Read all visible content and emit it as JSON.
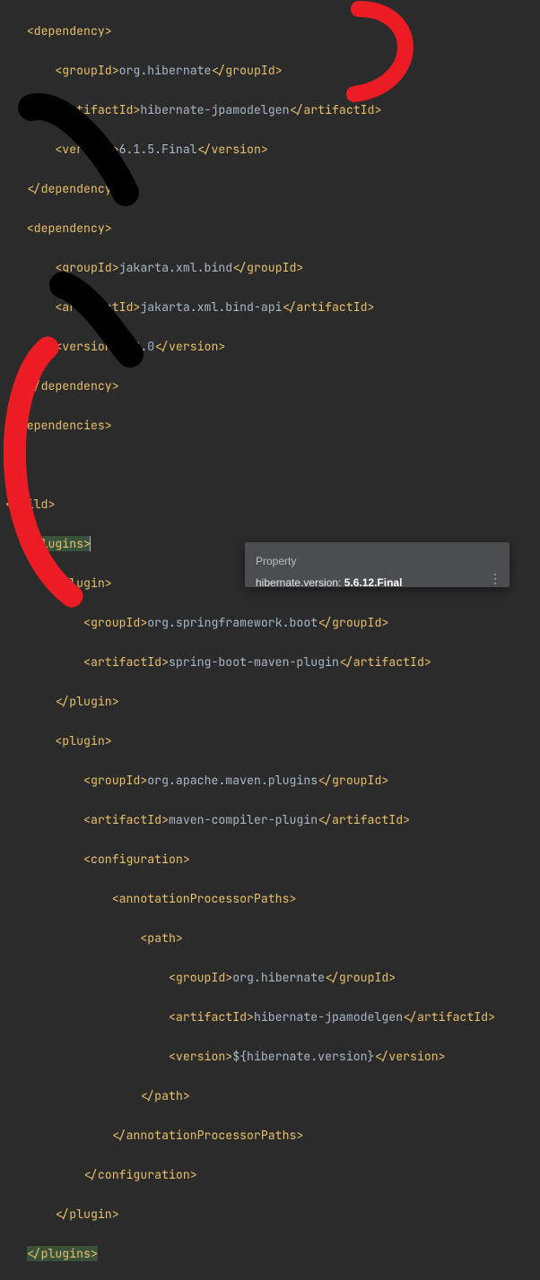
{
  "dep1": {
    "tag_open": "<dependency>",
    "groupId_open": "<groupId>",
    "groupId_val": "org.hibernate",
    "groupId_close": "</groupId>",
    "artifactId_open": "<artifactId>",
    "artifactId_val": "hibernate-jpamodelgen",
    "artifactId_close": "</artifactId>",
    "version_open": "<version>",
    "version_val": "6.1.5.Final",
    "version_close": "</version>",
    "tag_close": "</dependency>"
  },
  "dep2": {
    "tag_open": "<dependency>",
    "groupId_open": "<groupId>",
    "groupId_val": "jakarta.xml.bind",
    "groupId_close": "</groupId>",
    "artifactId_open": "<artifactId>",
    "artifactId_val": "jakarta.xml.bind-api",
    "artifactId_close": "</artifactId>",
    "version_open": "<version>",
    "version_val": "4.0.0",
    "version_close": "</version>",
    "tag_close": "</dependency>"
  },
  "dependencies_close": "</dependencies>",
  "build_open": "<build>",
  "plugins_open": "<plugins>",
  "plugin1": {
    "tag_open": "<plugin>",
    "groupId_open": "<groupId>",
    "groupId_val": "org.springframework.boot",
    "groupId_close": "</groupId>",
    "artifactId_open": "<artifactId>",
    "artifactId_val": "spring-boot-maven-plugin",
    "artifactId_close": "</artifactId>",
    "tag_close": "</plugin>"
  },
  "plugin2": {
    "tag_open": "<plugin>",
    "groupId_open": "<groupId>",
    "groupId_val": "org.apache.maven.plugins",
    "groupId_close": "</groupId>",
    "artifactId_open": "<artifactId>",
    "artifactId_val": "maven-compiler-plugin",
    "artifactId_close": "</artifactId>",
    "config_open": "<configuration>",
    "app_open": "<annotationProcessorPaths>",
    "path_open": "<path>",
    "p_groupId_open": "<groupId>",
    "p_groupId_val": "org.hibernate",
    "p_groupId_close": "</groupId>",
    "p_artifactId_open": "<artifactId>",
    "p_artifactId_val": "hibernate-jpamodelgen",
    "p_artifactId_close": "</artifactId>",
    "p_version_open": "<version>",
    "p_version_val": "${hibernate.version}",
    "p_version_close": "</version>",
    "path_close": "</path>",
    "app_close": "</annotationProcessorPaths>",
    "config_close": "</configuration>",
    "tag_close": "</plugin>"
  },
  "plugins_close": "</plugins>",
  "tooltip": {
    "title": "Property",
    "key": "hibernate.version: ",
    "val": "5.6.12.Final",
    "more_icon": "⋮"
  }
}
